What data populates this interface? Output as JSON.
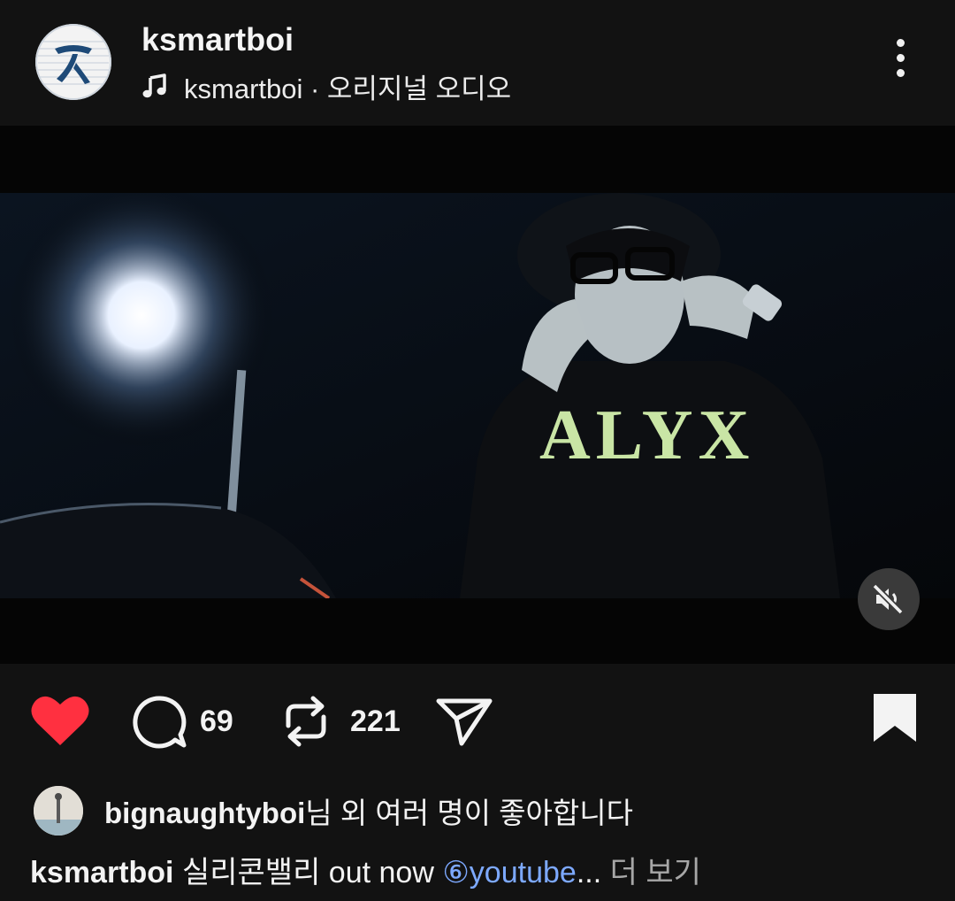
{
  "post": {
    "username": "ksmartboi",
    "audio_label": "ksmartboi · 오리지널 오디오",
    "icons": {
      "avatar": "aphex-logo-avatar",
      "audio": "music-note-icon",
      "more": "more-vertical-icon",
      "mute": "speaker-muted-icon",
      "like": "heart-filled-icon",
      "comment": "comment-bubble-icon",
      "repost": "repost-icon",
      "share": "send-icon",
      "save": "bookmark-filled-icon"
    }
  },
  "video": {
    "shirt_text": "ALYX"
  },
  "actions": {
    "comment_count": "69",
    "repost_count": "221"
  },
  "likes": {
    "user": "bignaughtyboi",
    "suffix": "님 외 여러 명이 좋아합니다"
  },
  "caption": {
    "user": "ksmartboi",
    "text": " 실리콘밸리 out now ",
    "link": "⑥youtube",
    "ellipsis": "...",
    "more": " 더 보기"
  },
  "colors": {
    "background": "#121212",
    "heart": "#ff3040",
    "link": "#7da9ff",
    "muted_text": "#a7a7a7"
  }
}
